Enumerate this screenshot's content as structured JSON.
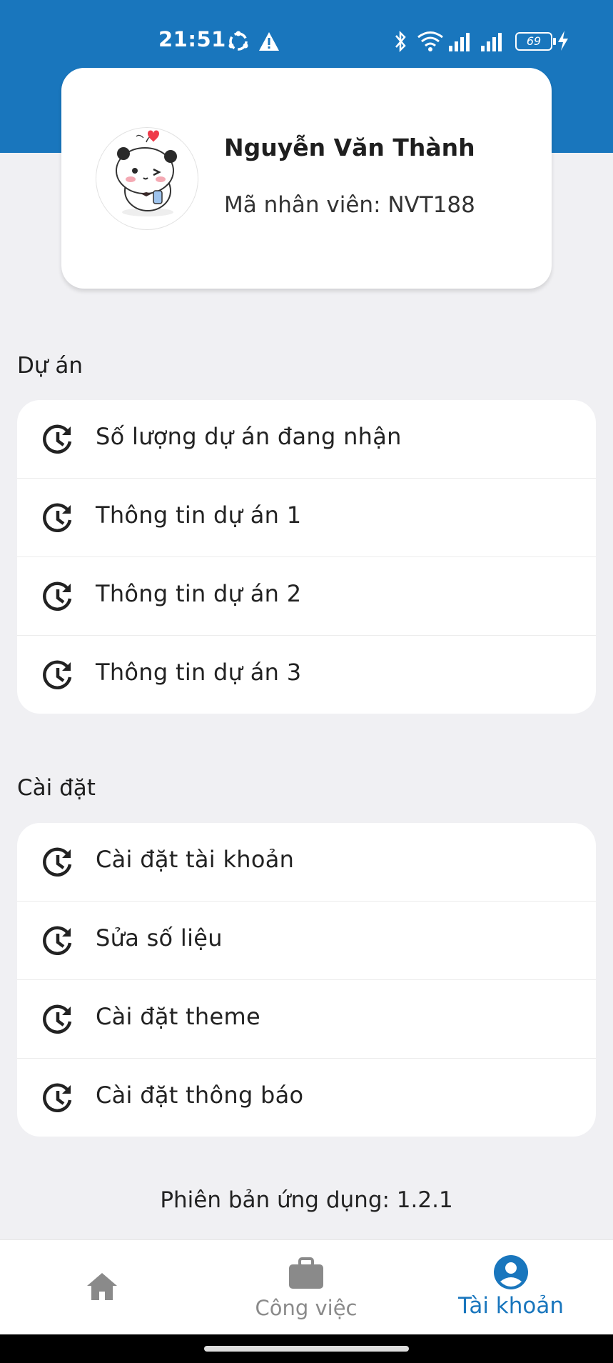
{
  "status_bar": {
    "time": "21:51",
    "battery": "69"
  },
  "profile": {
    "name": "Nguyễn Văn Thành",
    "employee_id": "Mã nhân viên: NVT188",
    "avatar_icon": "panda-avatar"
  },
  "projects": {
    "title": "Dự án",
    "items": [
      {
        "label": "Số lượng dự án đang nhận",
        "icon": "history-icon"
      },
      {
        "label": "Thông tin dự án 1",
        "icon": "history-icon"
      },
      {
        "label": "Thông tin dự án 2",
        "icon": "history-icon"
      },
      {
        "label": "Thông tin dự án 3",
        "icon": "history-icon"
      }
    ]
  },
  "settings": {
    "title": "Cài đặt",
    "items": [
      {
        "label": "Cài đặt tài khoản",
        "icon": "history-icon"
      },
      {
        "label": "Sửa số liệu",
        "icon": "history-icon"
      },
      {
        "label": "Cài đặt theme",
        "icon": "history-icon"
      },
      {
        "label": "Cài đặt thông báo",
        "icon": "history-icon"
      }
    ]
  },
  "version": "Phiên bản ứng dụng: 1.2.1",
  "bottom_nav": {
    "home_label": "",
    "work_label": "Công việc",
    "account_label": "Tài khoản",
    "active": "account"
  },
  "colors": {
    "primary": "#1976bd",
    "background": "#f0f0f3",
    "inactive": "#8a8a8a"
  }
}
